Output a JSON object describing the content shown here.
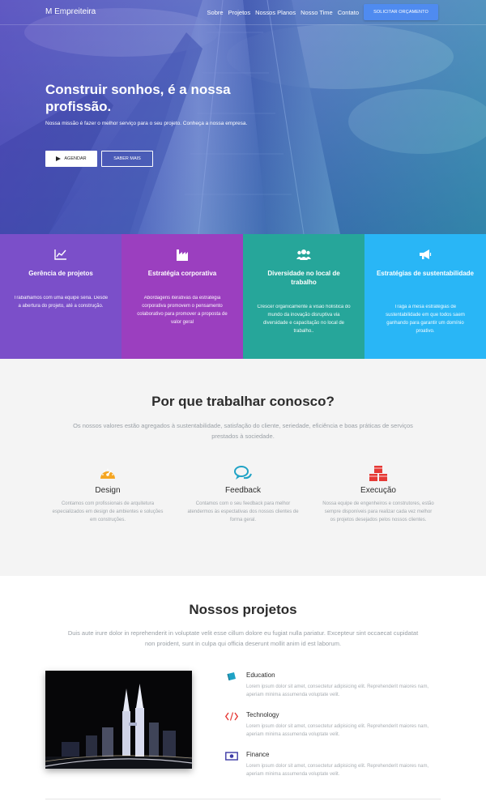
{
  "nav": {
    "brand": "M Empreiteira",
    "items": [
      "Sobre",
      "Projetos",
      "Nossos Planos",
      "Nosso Time",
      "Contato"
    ],
    "cta": "SOLICITAR ORÇAMENTO"
  },
  "hero": {
    "title": "Construir sonhos, é a nossa profissão.",
    "description": "Nossa missão é fazer o melhor serviço para o seu projeto. Conheça a nossa empresa.",
    "primary_button": "AGENDAR",
    "secondary_button": "SABER MAIS"
  },
  "cards": [
    {
      "icon": "line-chart-icon",
      "color": "#7b4fc9",
      "title": "Gerência de projetos",
      "text": "Trabalhamos com uma equipe séria. Desde a abertura do projeto, até a construção."
    },
    {
      "icon": "factory-icon",
      "color": "#9b3fbf",
      "title": "Estratégia corporativa",
      "text": "Abordagens iterativas da estratégia corporativa promovem o pensamento colaborativo para promover a proposta de valor geral"
    },
    {
      "icon": "users-icon",
      "color": "#26a69a",
      "title": "Diversidade no local de trabalho",
      "text": "Crescer organicamente a visão holística do mundo da inovação disruptiva via diversidade e capacitação no local de trabalho.."
    },
    {
      "icon": "bullhorn-icon",
      "color": "#29b6f6",
      "title": "Estratégias de sustentabilidade",
      "text": "Traga à mesa estratégias de sustentabilidade em que todos saem ganhando para garantir um domínio proativo."
    }
  ],
  "why": {
    "title": "Por que trabalhar conosco?",
    "subtitle": "Os nossos valores estão agregados à sustentabilidade, satisfação do cliente, seriedade, eficiência e boas práticas de serviços prestados à sociedade.",
    "features": [
      {
        "icon": "gauge-icon",
        "color": "#f5a623",
        "title": "Design",
        "text": "Contamos com profissionais de arquitetura especializados em design de ambientes e soluções em construções."
      },
      {
        "icon": "chat-icon",
        "color": "#1fa2c5",
        "title": "Feedback",
        "text": "Contamos com o seu feedback para melhor atendermos às espectativas dos nossos clientes de forma geral."
      },
      {
        "icon": "cubes-icon",
        "color": "#e53935",
        "title": "Execução",
        "text": "Nossa equipe de engenheiros e construtores, estão sempre disponíveis para realizar cada vez melhor os projetos desejados pelos nossos clientes."
      }
    ]
  },
  "projects": {
    "title": "Nossos projetos",
    "subtitle": "Duis aute irure dolor in reprehenderit in voluptate velit esse cillum dolore eu fugiat nulla pariatur. Excepteur sint occaecat cupidatat non proident, sunt in culpa qui officia deserunt mollit anim id est laborum.",
    "items": [
      {
        "icon": "book-icon",
        "color": "#1fa2c5",
        "title": "Education",
        "text": "Lorem ipsum dolor sit amet, consectetur adipisicing elit. Reprehenderit maiores nam, aperiam minima assumenda voluptate velit."
      },
      {
        "icon": "code-icon",
        "color": "#e53935",
        "title": "Technology",
        "text": "Lorem ipsum dolor sit amet, consectetur adipisicing elit. Reprehenderit maiores nam, aperiam minima assumenda voluptate velit."
      },
      {
        "icon": "money-icon",
        "color": "#3d3aa6",
        "title": "Finance",
        "text": "Lorem ipsum dolor sit amet, consectetur adipisicing elit. Reprehenderit maiores nam, aperiam minima assumenda voluptate velit."
      }
    ]
  }
}
